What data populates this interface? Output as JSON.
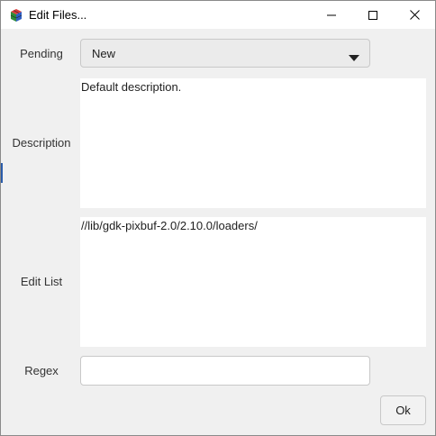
{
  "window": {
    "title": "Edit Files...",
    "icon": "rubiks-cube-app-icon",
    "controls": [
      "minimize-icon",
      "maximize-icon",
      "close-icon"
    ]
  },
  "form": {
    "pending": {
      "label": "Pending",
      "selected": "New"
    },
    "description": {
      "label": "Description",
      "value": "Default description."
    },
    "edit_list": {
      "label": "Edit List",
      "value": "//lib/gdk-pixbuf-2.0/2.10.0/loaders/"
    },
    "regex": {
      "label": "Regex",
      "value": ""
    },
    "ok_label": "Ok"
  },
  "colors": {
    "dialog_background": "#f0f0f0",
    "field_background": "#ffffff",
    "combo_background": "#ebebeb",
    "border": "#c8c8c8"
  }
}
